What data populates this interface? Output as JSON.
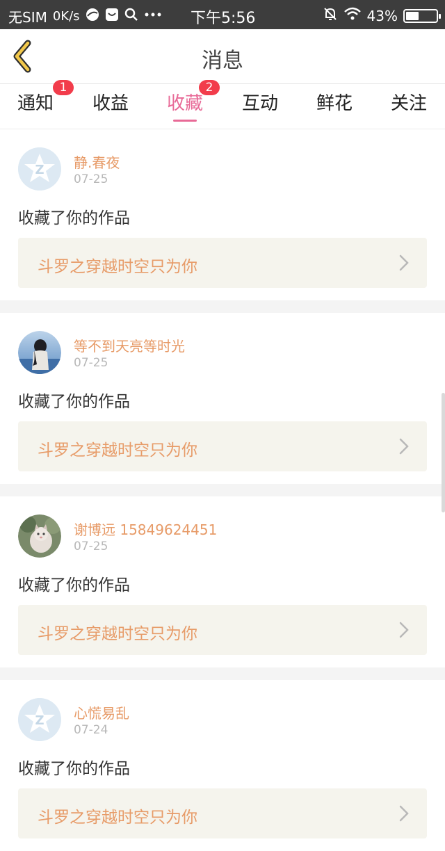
{
  "status_bar": {
    "carrier": "无SIM",
    "net_speed": "0K/s",
    "time": "下午5:56",
    "battery": "43%",
    "battery_level": 0.43
  },
  "header": {
    "title": "消息"
  },
  "tabs": [
    {
      "label": "通知",
      "badge": "1",
      "active": false
    },
    {
      "label": "收益",
      "badge": "",
      "active": false
    },
    {
      "label": "收藏",
      "badge": "2",
      "active": true
    },
    {
      "label": "互动",
      "badge": "",
      "active": false
    },
    {
      "label": "鲜花",
      "badge": "",
      "active": false
    },
    {
      "label": "关注",
      "badge": "",
      "active": false
    }
  ],
  "messages": [
    {
      "username": "静.春夜",
      "date": "07-25",
      "action": "收藏了你的作品",
      "work_title": "斗罗之穿越时空只为你",
      "avatar": "default-avatar"
    },
    {
      "username": "等不到天亮等时光",
      "date": "07-25",
      "action": "收藏了你的作品",
      "work_title": "斗罗之穿越时空只为你",
      "avatar": "photo-avatar-girl"
    },
    {
      "username": "谢博远 15849624451",
      "date": "07-25",
      "action": "收藏了你的作品",
      "work_title": "斗罗之穿越时空只为你",
      "avatar": "photo-avatar-cat"
    },
    {
      "username": "心慌易乱",
      "date": "07-24",
      "action": "收藏了你的作品",
      "work_title": "斗罗之穿越时空只为你",
      "avatar": "default-avatar"
    }
  ],
  "colors": {
    "accent": "#e86a97",
    "username": "#e79b68",
    "badge": "#f23c4b",
    "card_bg": "#f5f4ed"
  }
}
